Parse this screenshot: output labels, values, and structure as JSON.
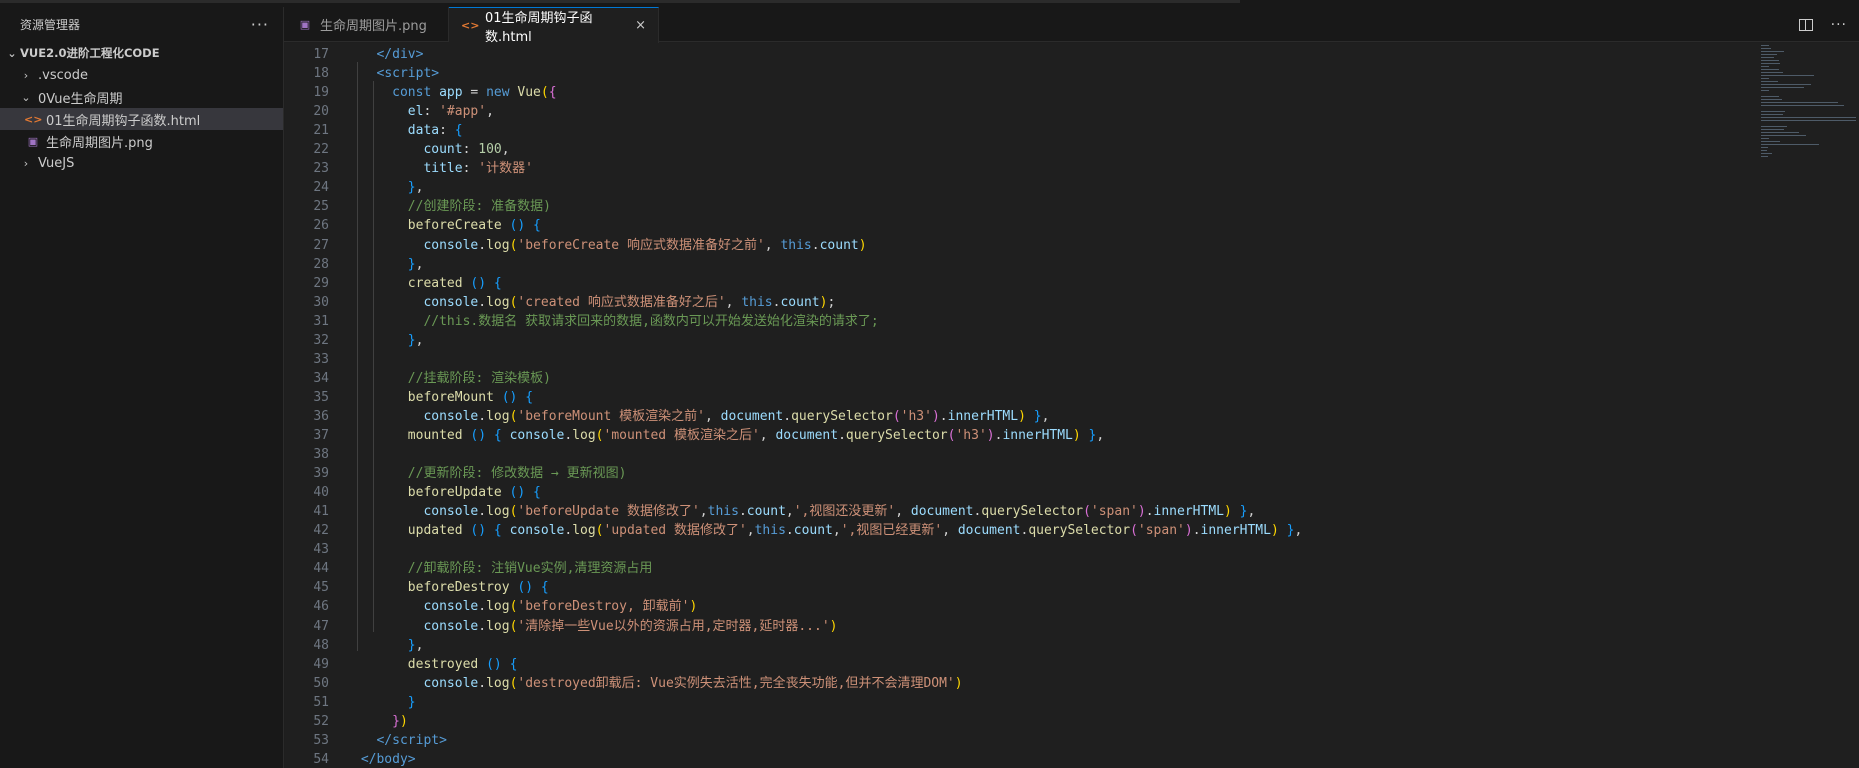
{
  "sidebar": {
    "title": "资源管理器",
    "more": "···",
    "root": "VUE2.0进阶工程化CODE",
    "items": [
      {
        "label": ".vscode",
        "depth": 1,
        "type": "folder",
        "chev": "›"
      },
      {
        "label": "0Vue生命周期",
        "depth": 1,
        "type": "folder",
        "chev": "⌄"
      },
      {
        "label": "01生命周期钩子函数.html",
        "depth": 2,
        "type": "html",
        "icon": "<>"
      },
      {
        "label": "生命周期图片.png",
        "depth": 2,
        "type": "png",
        "icon": "▣"
      },
      {
        "label": "VueJS",
        "depth": 1,
        "type": "folder",
        "chev": "›"
      }
    ]
  },
  "tabs": [
    {
      "label": "生命周期图片.png",
      "icon": "▣",
      "type": "png"
    },
    {
      "label": "01生命周期钩子函数.html",
      "icon": "<>",
      "type": "html",
      "close": "×"
    }
  ],
  "colors": {
    "keyword": "#569cd6",
    "control": "#c586c0",
    "string": "#ce9178",
    "comment": "#6a9955",
    "func": "#dcdcaa",
    "prop": "#9cdcfe",
    "number": "#b5cea8",
    "tag": "#569cd6",
    "bracket1": "#ffd700",
    "bracket2": "#da70d6",
    "bracket3": "#179fff"
  },
  "code_lines": [
    {
      "n": 17,
      "t": [
        [
          "   ",
          ""
        ],
        [
          "</",
          "tag"
        ],
        [
          "div",
          "tag"
        ],
        [
          ">",
          "tag"
        ]
      ]
    },
    {
      "n": 18,
      "t": [
        [
          "   ",
          ""
        ],
        [
          "<",
          "tag"
        ],
        [
          "script",
          "tag"
        ],
        [
          ">",
          "tag"
        ]
      ]
    },
    {
      "n": 19,
      "t": [
        [
          "     ",
          ""
        ],
        [
          "const",
          "keyword"
        ],
        [
          " ",
          ""
        ],
        [
          "app",
          "prop"
        ],
        [
          " = ",
          ""
        ],
        [
          "new",
          "keyword"
        ],
        [
          " ",
          ""
        ],
        [
          "Vue",
          "func"
        ],
        [
          "(",
          "bracket1"
        ],
        [
          "{",
          "bracket2"
        ]
      ]
    },
    {
      "n": 20,
      "t": [
        [
          "       ",
          ""
        ],
        [
          "el",
          "prop"
        ],
        [
          ": ",
          ""
        ],
        [
          "'#app'",
          "string"
        ],
        [
          ",",
          ""
        ]
      ]
    },
    {
      "n": 21,
      "t": [
        [
          "       ",
          ""
        ],
        [
          "data",
          "prop"
        ],
        [
          ": ",
          ""
        ],
        [
          "{",
          "bracket3"
        ]
      ]
    },
    {
      "n": 22,
      "t": [
        [
          "         ",
          ""
        ],
        [
          "count",
          "prop"
        ],
        [
          ": ",
          ""
        ],
        [
          "100",
          "number"
        ],
        [
          ",",
          ""
        ]
      ]
    },
    {
      "n": 23,
      "t": [
        [
          "         ",
          ""
        ],
        [
          "title",
          "prop"
        ],
        [
          ": ",
          ""
        ],
        [
          "'计数器'",
          "string"
        ]
      ]
    },
    {
      "n": 24,
      "t": [
        [
          "       ",
          ""
        ],
        [
          "}",
          "bracket3"
        ],
        [
          ",",
          ""
        ]
      ]
    },
    {
      "n": 25,
      "t": [
        [
          "       ",
          ""
        ],
        [
          "//创建阶段: 准备数据)",
          "comment"
        ]
      ]
    },
    {
      "n": 26,
      "t": [
        [
          "       ",
          ""
        ],
        [
          "beforeCreate",
          "func"
        ],
        [
          " ",
          ""
        ],
        [
          "()",
          "bracket3"
        ],
        [
          " ",
          ""
        ],
        [
          "{",
          "bracket3"
        ]
      ]
    },
    {
      "n": 27,
      "t": [
        [
          "         ",
          ""
        ],
        [
          "console",
          "prop"
        ],
        [
          ".",
          ""
        ],
        [
          "log",
          "func"
        ],
        [
          "(",
          "bracket1"
        ],
        [
          "'beforeCreate 响应式数据准备好之前'",
          "string"
        ],
        [
          ", ",
          ""
        ],
        [
          "this",
          "keyword"
        ],
        [
          ".",
          ""
        ],
        [
          "count",
          "prop"
        ],
        [
          ")",
          "bracket1"
        ]
      ]
    },
    {
      "n": 28,
      "t": [
        [
          "       ",
          ""
        ],
        [
          "}",
          "bracket3"
        ],
        [
          ",",
          ""
        ]
      ]
    },
    {
      "n": 29,
      "t": [
        [
          "       ",
          ""
        ],
        [
          "created",
          "func"
        ],
        [
          " ",
          ""
        ],
        [
          "()",
          "bracket3"
        ],
        [
          " ",
          ""
        ],
        [
          "{",
          "bracket3"
        ]
      ]
    },
    {
      "n": 30,
      "t": [
        [
          "         ",
          ""
        ],
        [
          "console",
          "prop"
        ],
        [
          ".",
          ""
        ],
        [
          "log",
          "func"
        ],
        [
          "(",
          "bracket1"
        ],
        [
          "'created 响应式数据准备好之后'",
          "string"
        ],
        [
          ", ",
          ""
        ],
        [
          "this",
          "keyword"
        ],
        [
          ".",
          ""
        ],
        [
          "count",
          "prop"
        ],
        [
          ")",
          "bracket1"
        ],
        [
          ";",
          ""
        ]
      ]
    },
    {
      "n": 31,
      "t": [
        [
          "         ",
          ""
        ],
        [
          "//this.数据名 获取请求回来的数据,函数内可以开始发送始化渲染的请求了;",
          "comment"
        ]
      ]
    },
    {
      "n": 32,
      "t": [
        [
          "       ",
          ""
        ],
        [
          "}",
          "bracket3"
        ],
        [
          ",",
          ""
        ]
      ]
    },
    {
      "n": 33,
      "t": [
        [
          "",
          ""
        ]
      ]
    },
    {
      "n": 34,
      "t": [
        [
          "       ",
          ""
        ],
        [
          "//挂载阶段: 渲染模板)",
          "comment"
        ]
      ]
    },
    {
      "n": 35,
      "t": [
        [
          "       ",
          ""
        ],
        [
          "beforeMount",
          "func"
        ],
        [
          " ",
          ""
        ],
        [
          "()",
          "bracket3"
        ],
        [
          " ",
          ""
        ],
        [
          "{",
          "bracket3"
        ]
      ]
    },
    {
      "n": 36,
      "t": [
        [
          "         ",
          ""
        ],
        [
          "console",
          "prop"
        ],
        [
          ".",
          ""
        ],
        [
          "log",
          "func"
        ],
        [
          "(",
          "bracket1"
        ],
        [
          "'beforeMount 模板渲染之前'",
          "string"
        ],
        [
          ", ",
          ""
        ],
        [
          "document",
          "prop"
        ],
        [
          ".",
          ""
        ],
        [
          "querySelector",
          "func"
        ],
        [
          "(",
          "bracket2"
        ],
        [
          "'h3'",
          "string"
        ],
        [
          ")",
          "bracket2"
        ],
        [
          ".",
          ""
        ],
        [
          "innerHTML",
          "prop"
        ],
        [
          ")",
          "bracket1"
        ],
        [
          " ",
          ""
        ],
        [
          "}",
          "bracket3"
        ],
        [
          ",",
          ""
        ]
      ]
    },
    {
      "n": 37,
      "t": [
        [
          "       ",
          ""
        ],
        [
          "mounted",
          "func"
        ],
        [
          " ",
          ""
        ],
        [
          "()",
          "bracket3"
        ],
        [
          " ",
          ""
        ],
        [
          "{",
          "bracket3"
        ],
        [
          " ",
          ""
        ],
        [
          "console",
          "prop"
        ],
        [
          ".",
          ""
        ],
        [
          "log",
          "func"
        ],
        [
          "(",
          "bracket1"
        ],
        [
          "'mounted 模板渲染之后'",
          "string"
        ],
        [
          ", ",
          ""
        ],
        [
          "document",
          "prop"
        ],
        [
          ".",
          ""
        ],
        [
          "querySelector",
          "func"
        ],
        [
          "(",
          "bracket2"
        ],
        [
          "'h3'",
          "string"
        ],
        [
          ")",
          "bracket2"
        ],
        [
          ".",
          ""
        ],
        [
          "innerHTML",
          "prop"
        ],
        [
          ")",
          "bracket1"
        ],
        [
          " ",
          ""
        ],
        [
          "}",
          "bracket3"
        ],
        [
          ",",
          ""
        ]
      ]
    },
    {
      "n": 38,
      "t": [
        [
          "",
          ""
        ]
      ]
    },
    {
      "n": 39,
      "t": [
        [
          "       ",
          ""
        ],
        [
          "//更新阶段: 修改数据 → 更新视图)",
          "comment"
        ]
      ]
    },
    {
      "n": 40,
      "t": [
        [
          "       ",
          ""
        ],
        [
          "beforeUpdate",
          "func"
        ],
        [
          " ",
          ""
        ],
        [
          "()",
          "bracket3"
        ],
        [
          " ",
          ""
        ],
        [
          "{",
          "bracket3"
        ]
      ]
    },
    {
      "n": 41,
      "t": [
        [
          "         ",
          ""
        ],
        [
          "console",
          "prop"
        ],
        [
          ".",
          ""
        ],
        [
          "log",
          "func"
        ],
        [
          "(",
          "bracket1"
        ],
        [
          "'beforeUpdate 数据修改了'",
          "string"
        ],
        [
          ",",
          ""
        ],
        [
          "this",
          "keyword"
        ],
        [
          ".",
          ""
        ],
        [
          "count",
          "prop"
        ],
        [
          ",",
          ""
        ],
        [
          "',视图还没更新'",
          "string"
        ],
        [
          ", ",
          ""
        ],
        [
          "document",
          "prop"
        ],
        [
          ".",
          ""
        ],
        [
          "querySelector",
          "func"
        ],
        [
          "(",
          "bracket2"
        ],
        [
          "'span'",
          "string"
        ],
        [
          ")",
          "bracket2"
        ],
        [
          ".",
          ""
        ],
        [
          "innerHTML",
          "prop"
        ],
        [
          ")",
          "bracket1"
        ],
        [
          " ",
          ""
        ],
        [
          "}",
          "bracket3"
        ],
        [
          ",",
          ""
        ]
      ]
    },
    {
      "n": 42,
      "t": [
        [
          "       ",
          ""
        ],
        [
          "updated",
          "func"
        ],
        [
          " ",
          ""
        ],
        [
          "()",
          "bracket3"
        ],
        [
          " ",
          ""
        ],
        [
          "{",
          "bracket3"
        ],
        [
          " ",
          ""
        ],
        [
          "console",
          "prop"
        ],
        [
          ".",
          ""
        ],
        [
          "log",
          "func"
        ],
        [
          "(",
          "bracket1"
        ],
        [
          "'updated 数据修改了'",
          "string"
        ],
        [
          ",",
          ""
        ],
        [
          "this",
          "keyword"
        ],
        [
          ".",
          ""
        ],
        [
          "count",
          "prop"
        ],
        [
          ",",
          ""
        ],
        [
          "',视图已经更新'",
          "string"
        ],
        [
          ", ",
          ""
        ],
        [
          "document",
          "prop"
        ],
        [
          ".",
          ""
        ],
        [
          "querySelector",
          "func"
        ],
        [
          "(",
          "bracket2"
        ],
        [
          "'span'",
          "string"
        ],
        [
          ")",
          "bracket2"
        ],
        [
          ".",
          ""
        ],
        [
          "innerHTML",
          "prop"
        ],
        [
          ")",
          "bracket1"
        ],
        [
          " ",
          ""
        ],
        [
          "}",
          "bracket3"
        ],
        [
          ",",
          ""
        ]
      ]
    },
    {
      "n": 43,
      "t": [
        [
          "",
          ""
        ]
      ]
    },
    {
      "n": 44,
      "t": [
        [
          "       ",
          ""
        ],
        [
          "//卸载阶段: 注销Vue实例,清理资源占用",
          "comment"
        ]
      ]
    },
    {
      "n": 45,
      "t": [
        [
          "       ",
          ""
        ],
        [
          "beforeDestroy",
          "func"
        ],
        [
          " ",
          ""
        ],
        [
          "()",
          "bracket3"
        ],
        [
          " ",
          ""
        ],
        [
          "{",
          "bracket3"
        ]
      ]
    },
    {
      "n": 46,
      "t": [
        [
          "         ",
          ""
        ],
        [
          "console",
          "prop"
        ],
        [
          ".",
          ""
        ],
        [
          "log",
          "func"
        ],
        [
          "(",
          "bracket1"
        ],
        [
          "'beforeDestroy, 卸载前'",
          "string"
        ],
        [
          ")",
          "bracket1"
        ]
      ]
    },
    {
      "n": 47,
      "t": [
        [
          "         ",
          ""
        ],
        [
          "console",
          "prop"
        ],
        [
          ".",
          ""
        ],
        [
          "log",
          "func"
        ],
        [
          "(",
          "bracket1"
        ],
        [
          "'清除掉一些Vue以外的资源占用,定时器,延时器...'",
          "string"
        ],
        [
          ")",
          "bracket1"
        ]
      ]
    },
    {
      "n": 48,
      "t": [
        [
          "       ",
          ""
        ],
        [
          "}",
          "bracket3"
        ],
        [
          ",",
          ""
        ]
      ]
    },
    {
      "n": 49,
      "t": [
        [
          "       ",
          ""
        ],
        [
          "destroyed",
          "func"
        ],
        [
          " ",
          ""
        ],
        [
          "()",
          "bracket3"
        ],
        [
          " ",
          ""
        ],
        [
          "{",
          "bracket3"
        ]
      ]
    },
    {
      "n": 50,
      "t": [
        [
          "         ",
          ""
        ],
        [
          "console",
          "prop"
        ],
        [
          ".",
          ""
        ],
        [
          "log",
          "func"
        ],
        [
          "(",
          "bracket1"
        ],
        [
          "'destroyed卸载后: Vue实例失去活性,完全丧失功能,但并不会清理DOM'",
          "string"
        ],
        [
          ")",
          "bracket1"
        ]
      ]
    },
    {
      "n": 51,
      "t": [
        [
          "       ",
          ""
        ],
        [
          "}",
          "bracket3"
        ]
      ]
    },
    {
      "n": 52,
      "t": [
        [
          "     ",
          ""
        ],
        [
          "}",
          "bracket2"
        ],
        [
          ")",
          "bracket1"
        ]
      ]
    },
    {
      "n": 53,
      "t": [
        [
          "   ",
          ""
        ],
        [
          "</",
          "tag"
        ],
        [
          "script",
          "tag"
        ],
        [
          ">",
          "tag"
        ]
      ]
    },
    {
      "n": 54,
      "t": [
        [
          " ",
          ""
        ],
        [
          "</",
          "tag"
        ],
        [
          "body",
          "tag"
        ],
        [
          ">",
          "tag"
        ]
      ]
    }
  ]
}
